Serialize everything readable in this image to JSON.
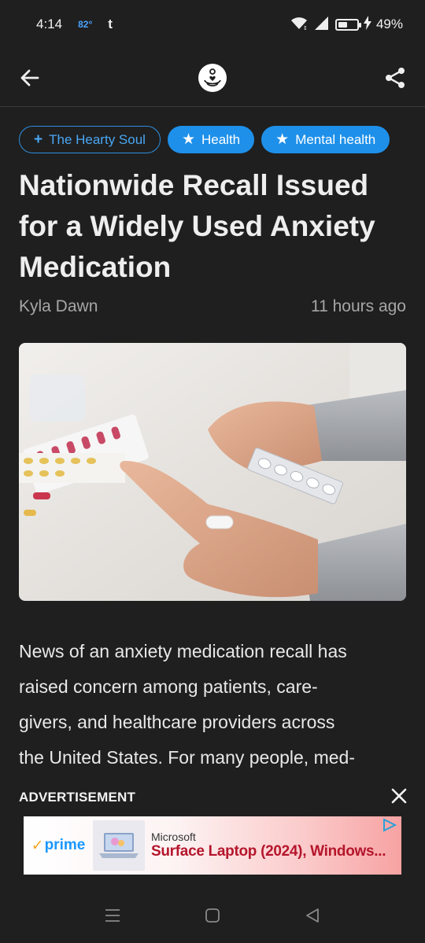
{
  "status_bar": {
    "time": "4:14",
    "temperature": "82°",
    "notification_letter": "t",
    "battery_percent": "49%",
    "battery_level": 0.49
  },
  "app_bar": {
    "back_icon": "arrow-left-icon",
    "logo_icon": "heart-lotus-logo",
    "share_icon": "share-icon"
  },
  "chips": [
    {
      "label": "The Hearty Soul",
      "icon": "+",
      "style": "outline"
    },
    {
      "label": "Health",
      "icon": "★",
      "style": "filled"
    },
    {
      "label": "Mental health",
      "icon": "★",
      "style": "filled"
    }
  ],
  "article": {
    "title": "Nationwide Recall Issued for a Widely Used Anxiety Medication",
    "author": "Kyla Dawn",
    "time_ago": "11 hours ago",
    "body_lines": [
      "News of an anxiety medication recall has",
      "raised concern among patients, care-",
      "givers, and healthcare providers across",
      "the United States. For many people, med-"
    ]
  },
  "advertisement": {
    "label": "ADVERTISEMENT",
    "prime_label": "prime",
    "brand": "Microsoft",
    "product": "Surface Laptop (2024), Windows..."
  },
  "colors": {
    "background": "#1f1f1f",
    "accent": "#1e90ea",
    "ad_product": "#b5162c"
  }
}
